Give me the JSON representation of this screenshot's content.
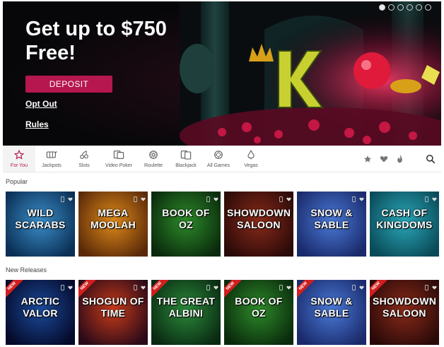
{
  "hero": {
    "title": "Get up to $750 Free!",
    "deposit_label": "DEPOSIT",
    "opt_out_label": "Opt Out",
    "rules_label": "Rules",
    "accent": "#b5174e"
  },
  "nav": {
    "items": [
      {
        "label": "For You",
        "icon": "star-icon"
      },
      {
        "label": "Jackpots",
        "icon": "jackpots-icon"
      },
      {
        "label": "Slots",
        "icon": "cherry-icon"
      },
      {
        "label": "Video Poker",
        "icon": "video-poker-icon"
      },
      {
        "label": "Roulette",
        "icon": "roulette-icon"
      },
      {
        "label": "Blackjack",
        "icon": "cards-icon"
      },
      {
        "label": "All Games",
        "icon": "chip-icon"
      },
      {
        "label": "Vegas",
        "icon": "vegas-icon"
      }
    ],
    "right_icons": [
      "star-icon",
      "heart-icon",
      "flame-icon",
      "search-icon"
    ]
  },
  "sections": [
    {
      "title": "Popular",
      "games": [
        {
          "name": "WILD SCARABS",
          "colors": [
            "#3a8ec9",
            "#0b2f55"
          ]
        },
        {
          "name": "MEGA MOOLAH",
          "colors": [
            "#e08a1a",
            "#5a2a08"
          ]
        },
        {
          "name": "BOOK OF OZ",
          "colors": [
            "#2d8a2a",
            "#0a2a0c"
          ]
        },
        {
          "name": "SHOWDOWN SALOON",
          "colors": [
            "#8a2a1a",
            "#2a0a08"
          ]
        },
        {
          "name": "SNOW & SABLE",
          "colors": [
            "#4a7ad8",
            "#1a2a6a"
          ]
        },
        {
          "name": "CASH OF KINGDOMS",
          "colors": [
            "#2aa8b8",
            "#0a4a58"
          ]
        }
      ]
    },
    {
      "title": "New Releases",
      "badge": "NEW",
      "games": [
        {
          "name": "ARCTIC VALOR",
          "colors": [
            "#1a4a9a",
            "#050a2a"
          ]
        },
        {
          "name": "SHOGUN OF TIME",
          "colors": [
            "#c83a1a",
            "#2a0a18"
          ]
        },
        {
          "name": "THE GREAT ALBINI",
          "colors": [
            "#2a8a3a",
            "#0a2a12"
          ]
        },
        {
          "name": "BOOK OF OZ",
          "colors": [
            "#2d8a2a",
            "#0a2a0c"
          ]
        },
        {
          "name": "SNOW & SABLE",
          "colors": [
            "#4a7ad8",
            "#1a2a6a"
          ]
        },
        {
          "name": "SHOWDOWN SALOON",
          "colors": [
            "#8a2a1a",
            "#2a0a08"
          ]
        }
      ]
    }
  ]
}
